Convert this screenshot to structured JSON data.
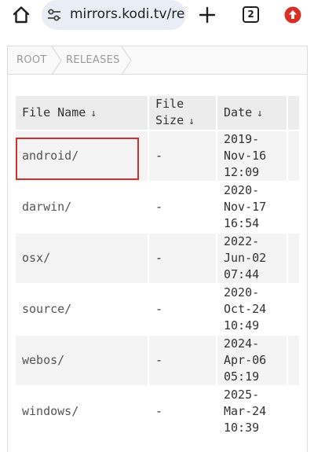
{
  "browser": {
    "url": "mirrors.kodi.tv/re",
    "tab_count": "2",
    "icons": {
      "home": "home-icon",
      "site_settings": "tune-icon",
      "new_tab": "plus-icon",
      "tabs": "tab-switcher-icon",
      "update": "update-arrow-icon"
    },
    "update_color": "#d93025"
  },
  "breadcrumb": {
    "items": [
      "ROOT",
      "RELEASES"
    ]
  },
  "table": {
    "headers": {
      "name": "File Name",
      "size_line1": "File",
      "size_line2": "Size",
      "date": "Date",
      "sort_arrow": "↓"
    },
    "rows": [
      {
        "name": "android/",
        "size": "-",
        "date": [
          "2019-",
          "Nov-16",
          "12:09"
        ]
      },
      {
        "name": "darwin/",
        "size": "-",
        "date": [
          "2020-",
          "Nov-17",
          "16:54"
        ]
      },
      {
        "name": "osx/",
        "size": "-",
        "date": [
          "2022-",
          "Jun-02",
          "07:44"
        ]
      },
      {
        "name": "source/",
        "size": "-",
        "date": [
          "2020-",
          "Oct-24",
          "10:49"
        ]
      },
      {
        "name": "webos/",
        "size": "-",
        "date": [
          "2024-",
          "Apr-06",
          "05:19"
        ]
      },
      {
        "name": "windows/",
        "size": "-",
        "date": [
          "2025-",
          "Mar-24",
          "10:39"
        ]
      }
    ]
  },
  "highlight_color": "#d32f2f"
}
